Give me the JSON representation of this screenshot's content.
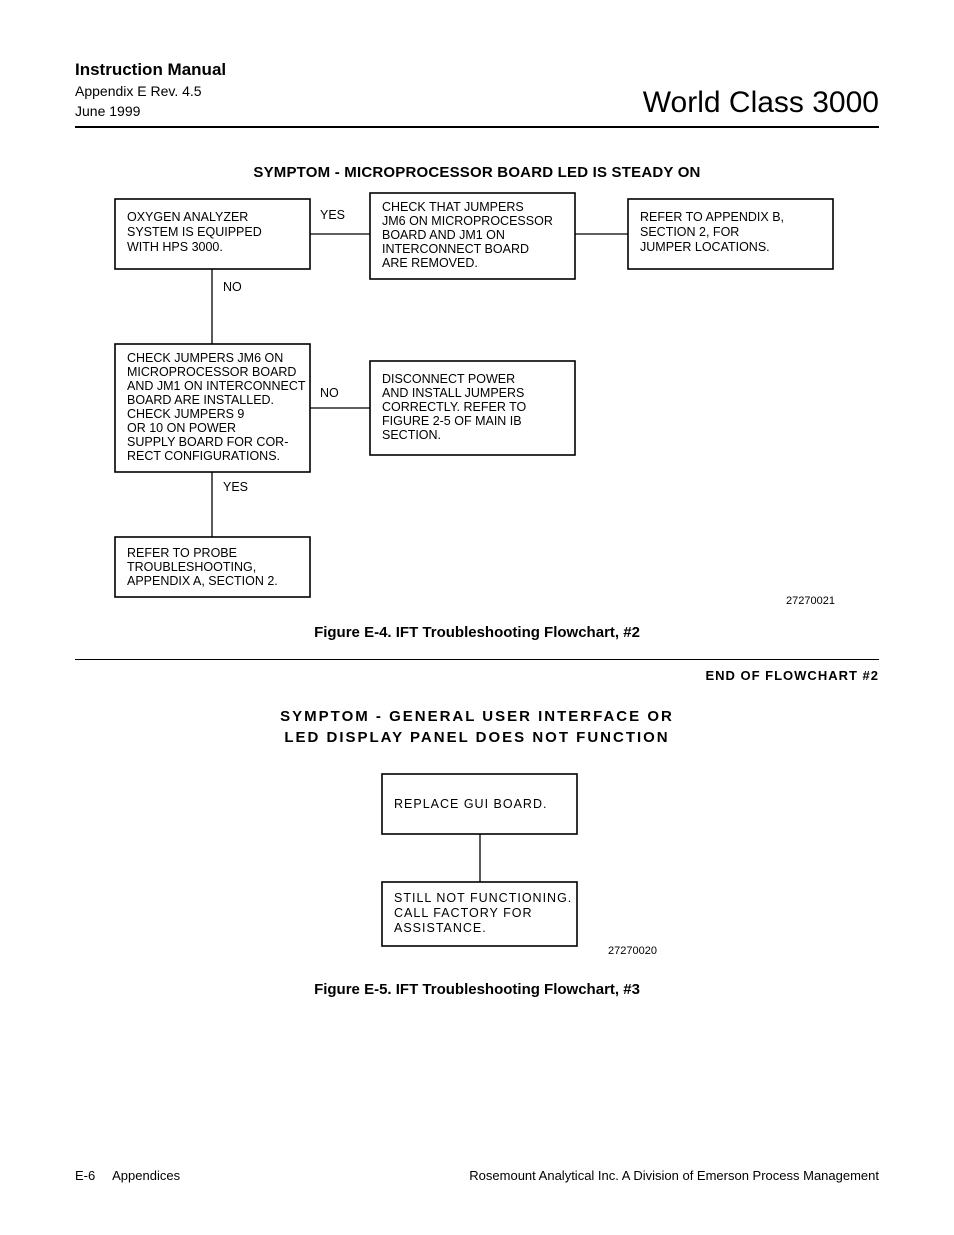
{
  "header": {
    "title": "Instruction Manual",
    "appendix": "Appendix E  Rev. 4.5",
    "date": "June 1999",
    "product": "World Class 3000"
  },
  "flowchart1": {
    "symptom": "SYMPTOM - MICROPROCESSOR BOARD LED IS STEADY ON",
    "box_a": "OXYGEN ANALYZER\nSYSTEM IS EQUIPPED\nWITH HPS 3000.",
    "box_b": "CHECK THAT JUMPERS\nJM6 ON MICROPROCESSOR\nBOARD AND JM1 ON\nINTERCONNECT BOARD\nARE REMOVED.",
    "box_c": "REFER TO APPENDIX B,\nSECTION 2, FOR\nJUMPER LOCATIONS.",
    "box_d": "CHECK JUMPERS JM6 ON\nMICROPROCESSOR BOARD\nAND JM1 ON INTERCONNECT\nBOARD ARE INSTALLED.\nCHECK JUMPERS 9\nOR 10 ON POWER\nSUPPLY BOARD FOR COR-\nRECT CONFIGURATIONS.",
    "box_e": "DISCONNECT POWER\nAND INSTALL JUMPERS\nCORRECTLY.  REFER TO\nFIGURE 2-5 OF MAIN IB\nSECTION.",
    "box_f": "REFER TO PROBE\nTROUBLESHOOTING,\nAPPENDIX A, SECTION 2.",
    "yes1": "YES",
    "no1": "NO",
    "no2": "NO",
    "yes2": "YES",
    "refnum": "27270021",
    "caption": "Figure E-4.  IFT Troubleshooting Flowchart, #2",
    "endnote": "END  OF  FLOWCHART  #2"
  },
  "flowchart2": {
    "symptom_line1": "SYMPTOM -  GENERAL  USER  INTERFACE  OR",
    "symptom_line2": "LED  DISPLAY  PANEL  DOES  NOT  FUNCTION",
    "box_g": "REPLACE  GUI  BOARD.",
    "box_h": "STILL  NOT  FUNCTIONING.\nCALL  FACTORY  FOR\nASSISTANCE.",
    "refnum": "27270020",
    "caption": "Figure E-5.  IFT Troubleshooting Flowchart, #3"
  },
  "footer": {
    "pagenum": "E-6",
    "section": "Appendices",
    "company": "Rosemount Analytical Inc.    A Division of Emerson Process Management"
  }
}
